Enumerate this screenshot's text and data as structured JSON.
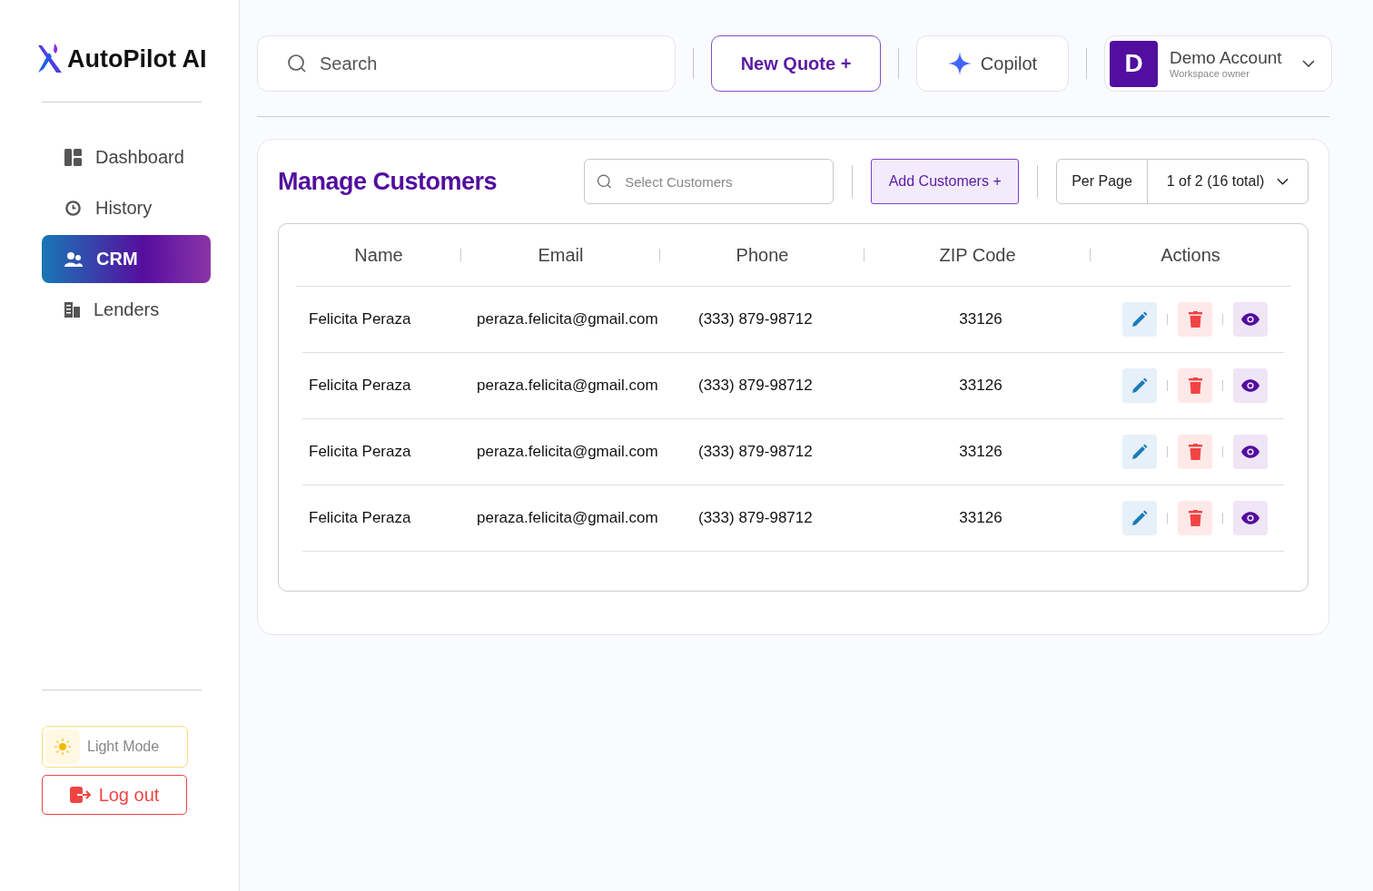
{
  "brand": "AutoPilot AI",
  "nav": [
    {
      "label": "Dashboard",
      "selected": false
    },
    {
      "label": "History",
      "selected": false
    },
    {
      "label": "CRM",
      "selected": true
    },
    {
      "label": "Lenders",
      "selected": false
    }
  ],
  "theme_toggle": {
    "label": "Light Mode"
  },
  "logout": {
    "label": "Log out"
  },
  "search": {
    "placeholder": "Search"
  },
  "new_quote": "New Quote +",
  "copilot": "Copilot",
  "account": {
    "initial": "D",
    "name": "Demo Account",
    "role": "Workspace owner"
  },
  "panel": {
    "title": "Manage Customers",
    "filter": {
      "placeholder": "Select Customers"
    },
    "add_button": "Add Customers +",
    "per_page": {
      "label": "Per Page",
      "value": "1 of 2 (16 total)"
    }
  },
  "table": {
    "columns": [
      "Name",
      "Email",
      "Phone",
      "ZIP Code",
      "Actions"
    ],
    "rows": [
      {
        "name": "Felicita Peraza",
        "email": "peraza.felicita@gmail.com",
        "phone": "(333) 879-98712",
        "zip": "33126"
      },
      {
        "name": "Felicita Peraza",
        "email": "peraza.felicita@gmail.com",
        "phone": "(333) 879-98712",
        "zip": "33126"
      },
      {
        "name": "Felicita Peraza",
        "email": "peraza.felicita@gmail.com",
        "phone": "(333) 879-98712",
        "zip": "33126"
      },
      {
        "name": "Felicita Peraza",
        "email": "peraza.felicita@gmail.com",
        "phone": "(333) 879-98712",
        "zip": "33126"
      }
    ]
  }
}
